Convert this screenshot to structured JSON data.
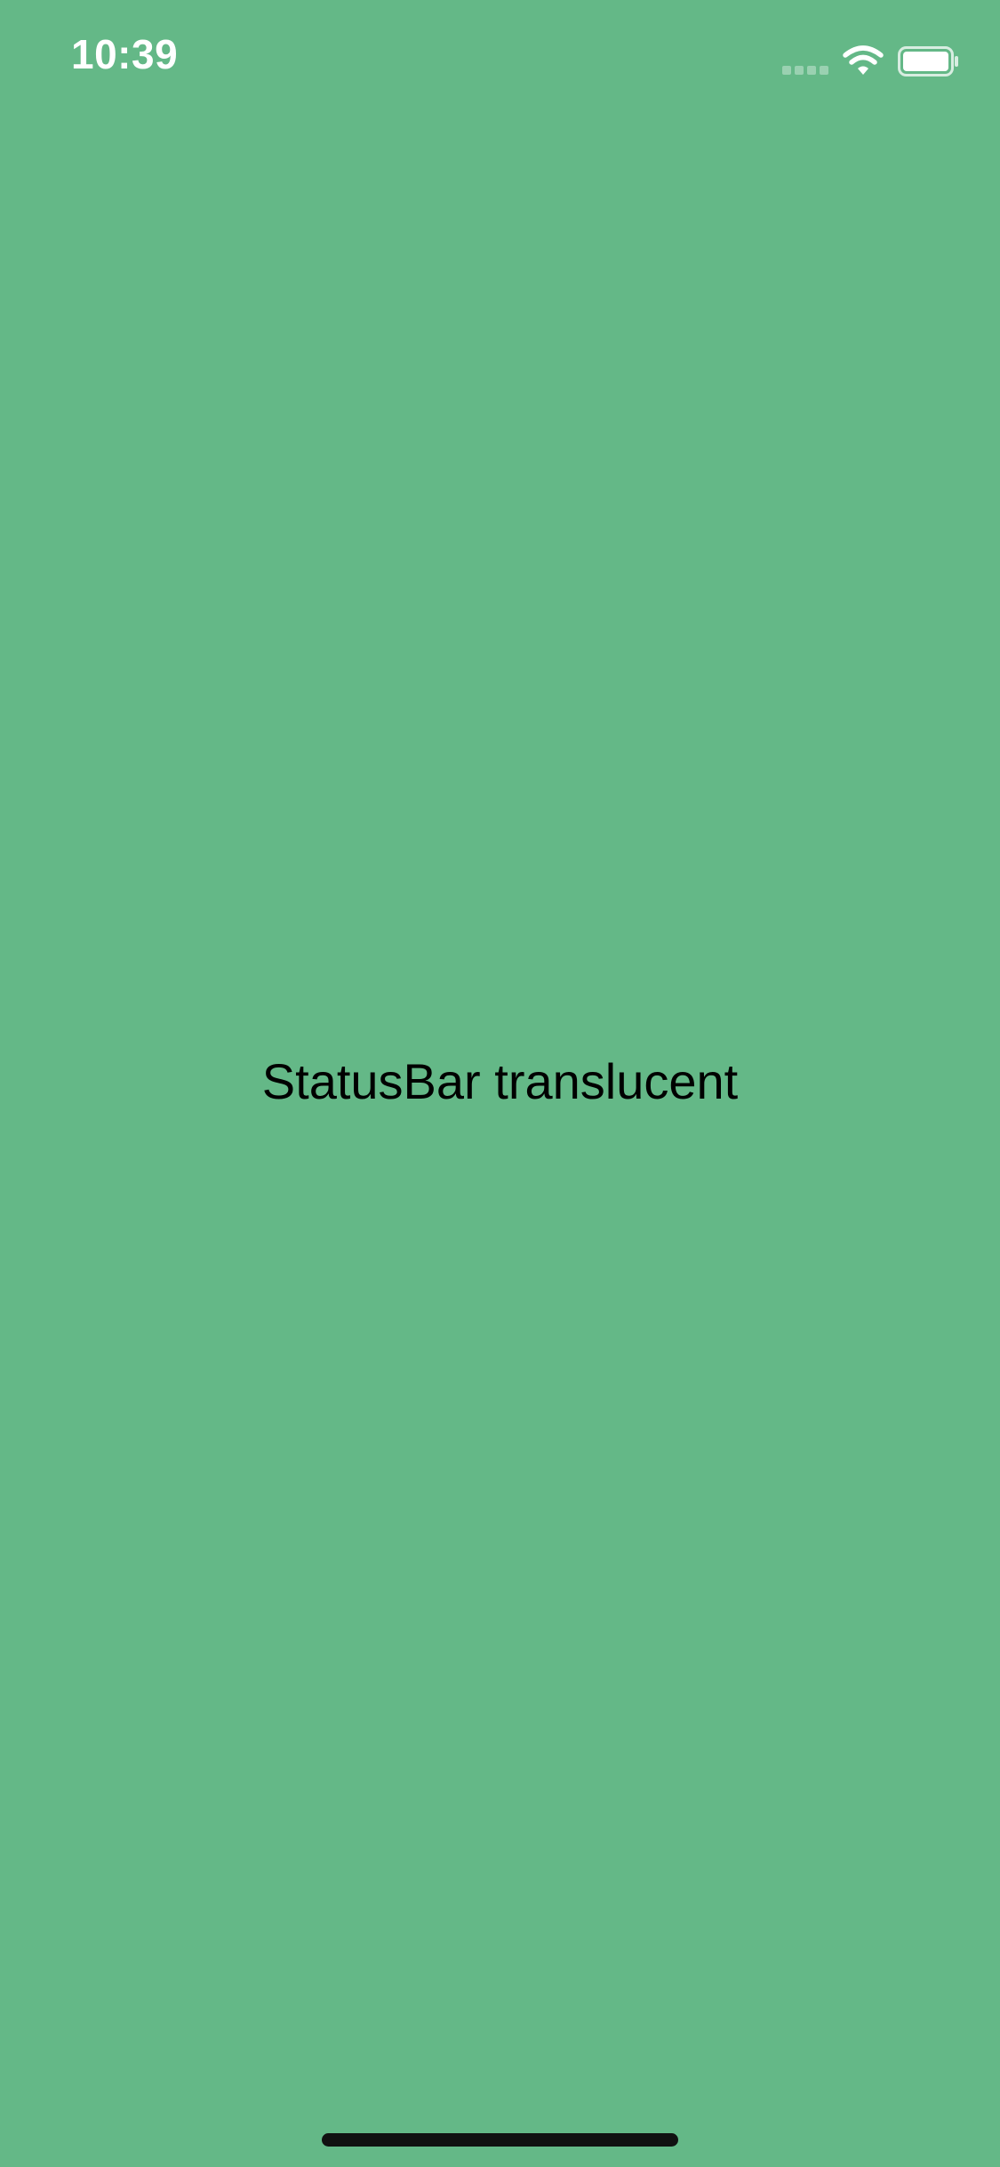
{
  "theme": {
    "background_color": "#64b887",
    "status_text_color": "#ffffff",
    "label_color": "#000000",
    "home_indicator_color": "#111111"
  },
  "status_bar": {
    "time": "10:39",
    "icons": [
      "cellular-signal-icon",
      "wifi-icon",
      "battery-icon"
    ]
  },
  "main": {
    "label": "StatusBar translucent"
  }
}
